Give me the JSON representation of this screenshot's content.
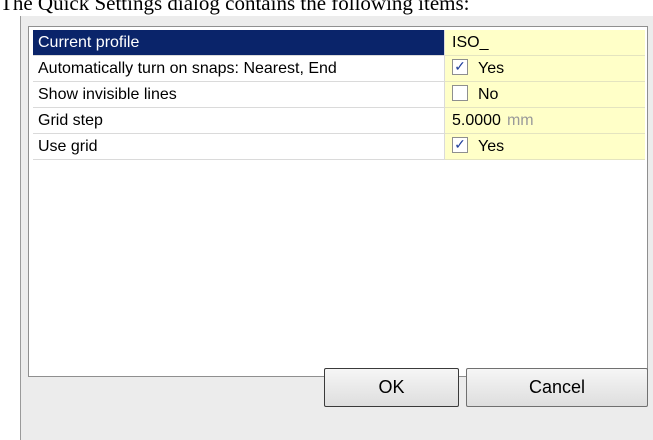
{
  "caption": "The Quick Settings dialog contains the following items:",
  "properties": [
    {
      "name": "Current profile",
      "value": "ISO_"
    },
    {
      "name": "Automatically turn on snaps: Nearest, End",
      "value": "Yes",
      "checkbox": "checked"
    },
    {
      "name": "Show invisible lines",
      "value": "No",
      "checkbox": "unchecked"
    },
    {
      "name": "Grid step",
      "value": "5.0000",
      "unit": "mm"
    },
    {
      "name": "Use grid",
      "value": "Yes",
      "checkbox": "checked"
    }
  ],
  "buttons": {
    "ok": "OK",
    "cancel": "Cancel"
  },
  "colors": {
    "selection": "#0a246a",
    "value_background": "#ffffc8",
    "check": "#21409a"
  },
  "icons": {
    "checked": "✓"
  }
}
